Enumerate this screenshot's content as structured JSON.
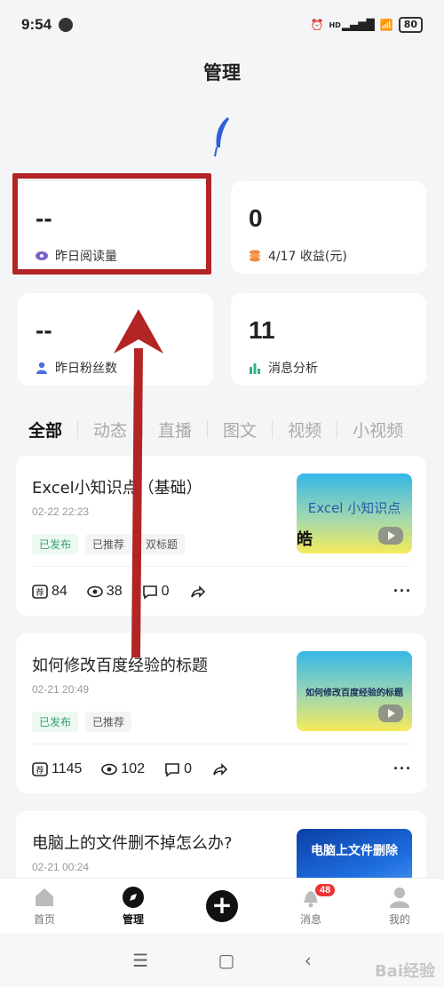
{
  "status_bar": {
    "time": "9:54",
    "battery": "80",
    "network": "HD"
  },
  "header": {
    "title": "管理"
  },
  "stats": [
    {
      "value": "--",
      "label": "昨日阅读量",
      "icon": "eye-icon",
      "color": "#7b61c9"
    },
    {
      "value": "0",
      "label": "4/17 收益(元)",
      "icon": "coins-icon",
      "color": "#f08a3c"
    },
    {
      "value": "--",
      "label": "昨日粉丝数",
      "icon": "person-icon",
      "color": "#4a6fe0"
    },
    {
      "value": "11",
      "label": "消息分析",
      "icon": "bar-chart-icon",
      "color": "#2fb38a"
    }
  ],
  "tabs": [
    "全部",
    "动态",
    "直播",
    "图文",
    "视频",
    "小视频"
  ],
  "articles": [
    {
      "title": "Excel小知识点（基础）",
      "date": "02-22 22:23",
      "tags": [
        "已发布",
        "已推荐",
        "双标题"
      ],
      "thumb_text": "Excel 小知识点",
      "thumb_sub": "皓",
      "recommend": "84",
      "views": "38",
      "comments": "0"
    },
    {
      "title": "如何修改百度经验的标题",
      "date": "02-21 20:49",
      "tags": [
        "已发布",
        "已推荐"
      ],
      "thumb_text": "如何修改百度经验的标题",
      "recommend": "1145",
      "views": "102",
      "comments": "0"
    },
    {
      "title": "电脑上的文件删不掉怎么办?",
      "date": "02-21 00:24",
      "thumb_text": "电脑上文件删除"
    }
  ],
  "bottom_nav": [
    {
      "label": "首页",
      "icon": "home-icon"
    },
    {
      "label": "管理",
      "icon": "compass-icon"
    },
    {
      "label": "",
      "icon": "plus-icon"
    },
    {
      "label": "消息",
      "icon": "bell-icon",
      "badge": "48"
    },
    {
      "label": "我的",
      "icon": "user-icon"
    }
  ],
  "watermark": "Bai经验"
}
